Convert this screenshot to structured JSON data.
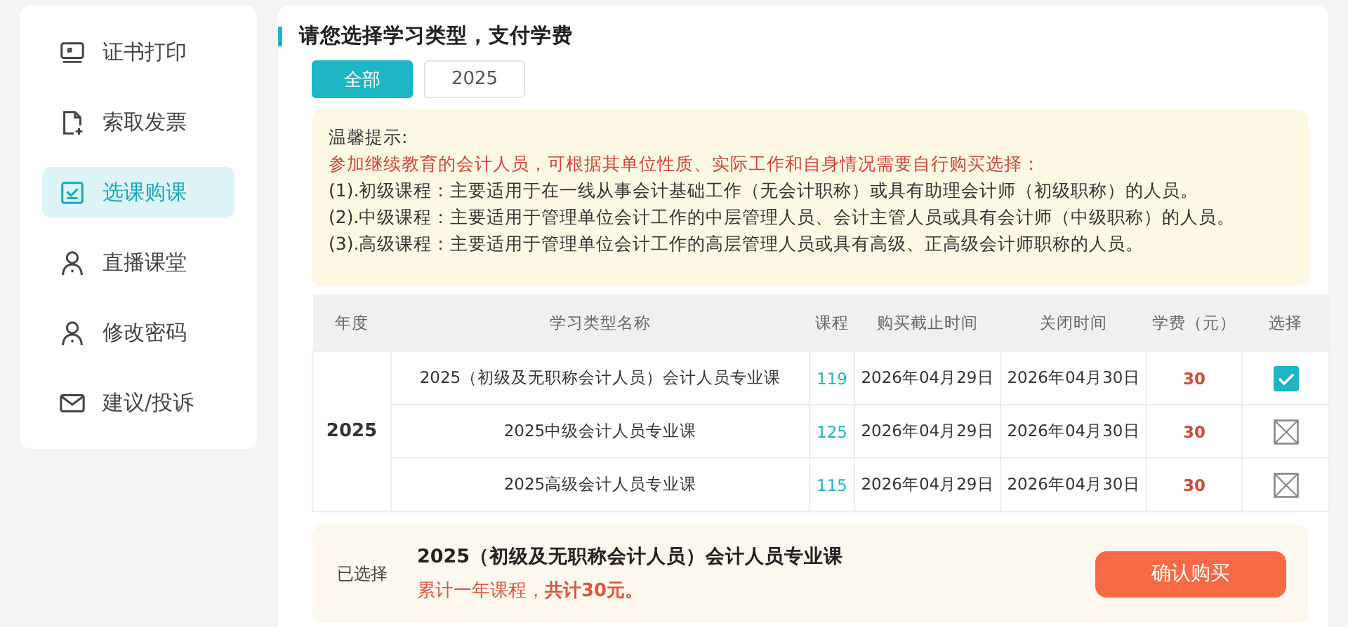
{
  "sidebar": {
    "items": [
      {
        "label": "证书打印",
        "selected": false
      },
      {
        "label": "索取发票",
        "selected": false
      },
      {
        "label": "选课购课",
        "selected": true
      },
      {
        "label": "直播课堂",
        "selected": false
      },
      {
        "label": "修改密码",
        "selected": false
      },
      {
        "label": "建议/投诉",
        "selected": false
      }
    ]
  },
  "main": {
    "title": "请您选择学习类型，支付学费",
    "tabs": [
      {
        "label": "全部",
        "selected": true
      },
      {
        "label": "2025",
        "selected": false
      }
    ],
    "notice": {
      "heading": "温馨提示:",
      "highlight": "参加继续教育的会计人员，可根据其单位性质、实际工作和自身情况需要自行购买选择：",
      "lines": [
        "(1).初级课程：主要适用于在一线从事会计基础工作（无会计职称）或具有助理会计师（初级职称）的人员。",
        "(2).中级课程：主要适用于管理单位会计工作的中层管理人员、会计主管人员或具有会计师（中级职称）的人员。",
        "(3).高级课程：主要适用于管理单位会计工作的高层管理人员或具有高级、正高级会计师职称的人员。"
      ]
    },
    "table": {
      "columns": [
        "年度",
        "学习类型名称",
        "课程",
        "购买截止时间",
        "关闭时间",
        "学费（元）",
        "选择"
      ],
      "groups": [
        {
          "year": "2025",
          "rows": [
            {
              "name": "2025（初级及无职称会计人员）会计人员专业课",
              "courses": "119",
              "deadline": "2026年04月29日",
              "close": "2026年04月30日",
              "fee": "30",
              "selected": true
            },
            {
              "name": "2025中级会计人员专业课",
              "courses": "125",
              "deadline": "2026年04月29日",
              "close": "2026年04月30日",
              "fee": "30",
              "selected": false
            },
            {
              "name": "2025高级会计人员专业课",
              "courses": "115",
              "deadline": "2026年04月29日",
              "close": "2026年04月30日",
              "fee": "30",
              "selected": false
            }
          ]
        }
      ]
    },
    "summary": {
      "label": "已选择",
      "course": "2025（初级及无职称会计人员）会计人员专业课",
      "total": "累计一年课程，**共计30元。**",
      "button": "确认购买"
    }
  }
}
